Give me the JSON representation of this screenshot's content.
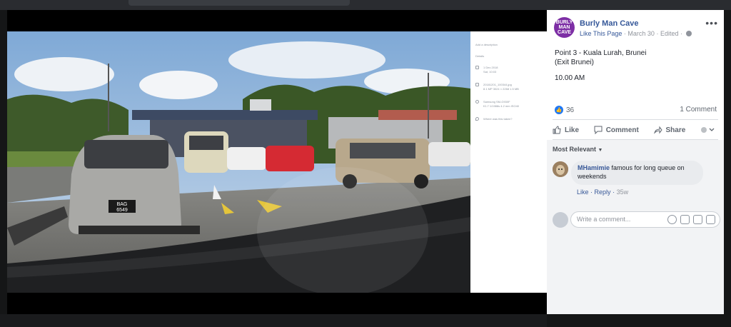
{
  "post": {
    "page_name": "Burly Man Cave",
    "avatar_text": "BURLY MAN CAVE",
    "like_page": "Like This Page",
    "date": "March 30",
    "edited": "Edited",
    "more": "•••",
    "text_line1": "Point 3 - Kuala Lurah, Brunei",
    "text_line2": "(Exit Brunei)",
    "time": "10.00 AM",
    "reaction_count": "36",
    "comment_count": "1 Comment"
  },
  "actions": {
    "like": "Like",
    "comment": "Comment",
    "share": "Share"
  },
  "comments": {
    "sort_label": "Most Relevant",
    "items": [
      {
        "author": "MHamimie",
        "text": "famous for long queue on weekends",
        "like": "Like",
        "reply": "Reply",
        "age": "35w"
      }
    ],
    "write_placeholder": "Write a comment..."
  },
  "photo_panel": {
    "add_description": "Add a description",
    "section": "Details",
    "date": "1 Dec 2018",
    "time_detail": "Sat, 10:03",
    "filename": "20181201_100344.jpg",
    "file_meta": "8.1 MP  3024 × 2268  1.5 MB",
    "camera": "Samsung SM-G930F",
    "camera_meta": "f/1.7  1/1988s  4.2 mm  ISO40",
    "location_prompt": "Where was this taken?"
  },
  "photo": {
    "plate": "BAG 6549"
  }
}
